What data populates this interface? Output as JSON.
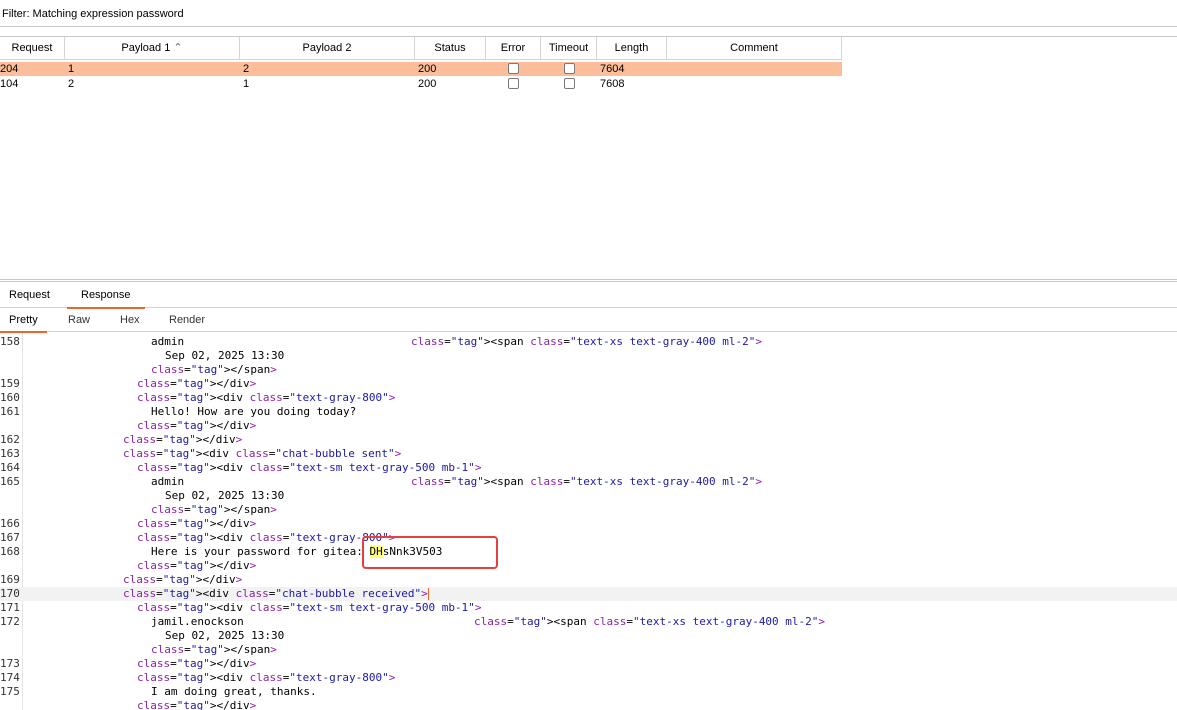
{
  "filter": {
    "text": "Filter: Matching expression password"
  },
  "table": {
    "columns": [
      "Request",
      "Payload 1",
      "Payload 2",
      "Status",
      "Error",
      "Timeout",
      "Length",
      "Comment"
    ],
    "sort_indicator": "^",
    "rows": [
      {
        "request": "204",
        "payload1": "1",
        "payload2": "2",
        "status": "200",
        "length": "7604",
        "comment": "",
        "selected": true
      },
      {
        "request": "104",
        "payload1": "2",
        "payload2": "1",
        "status": "200",
        "length": "7608",
        "comment": "",
        "selected": false
      }
    ]
  },
  "tabs": {
    "request": "Request",
    "response": "Response"
  },
  "subtabs": {
    "pretty": "Pretty",
    "raw": "Raw",
    "hex": "Hex",
    "render": "Render"
  },
  "code": {
    "lines": [
      {
        "n": "158",
        "t1": "admin",
        "t2": "<span class=\"text-xs text-gray-400 ml-2\">"
      },
      {
        "n": "",
        "t1": "Sep 02, 2025 13:30"
      },
      {
        "n": "",
        "t1": "</span>"
      },
      {
        "n": "159",
        "t1": "</div>"
      },
      {
        "n": "160",
        "t1": "<div class=\"text-gray-800\">"
      },
      {
        "n": "161",
        "t1": "Hello! How are you doing today?"
      },
      {
        "n": "",
        "t1": "</div>"
      },
      {
        "n": "162",
        "t1": "</div>"
      },
      {
        "n": "163",
        "t1": "<div class=\"chat-bubble sent\">"
      },
      {
        "n": "164",
        "t1": "<div class=\"text-sm text-gray-500 mb-1\">"
      },
      {
        "n": "165",
        "t1": "admin",
        "t2": "<span class=\"text-xs text-gray-400 ml-2\">"
      },
      {
        "n": "",
        "t1": "Sep 02, 2025 13:30"
      },
      {
        "n": "",
        "t1": "</span>"
      },
      {
        "n": "166",
        "t1": "</div>"
      },
      {
        "n": "167",
        "t1": "<div class=\"text-gray-800\">"
      },
      {
        "n": "168",
        "t1": "Here is your password for gitea: ",
        "hl": "DH",
        "t3": "sNnk3V503"
      },
      {
        "n": "",
        "t1": "</div>"
      },
      {
        "n": "169",
        "t1": "</div>"
      },
      {
        "n": "170",
        "t1": "<div class=\"chat-bubble received\">"
      },
      {
        "n": "171",
        "t1": "<div class=\"text-sm text-gray-500 mb-1\">"
      },
      {
        "n": "172",
        "t1": "jamil.enockson",
        "t2": "<span class=\"text-xs text-gray-400 ml-2\">"
      },
      {
        "n": "",
        "t1": "Sep 02, 2025 13:30"
      },
      {
        "n": "",
        "t1": "</span>"
      },
      {
        "n": "173",
        "t1": "</div>"
      },
      {
        "n": "174",
        "t1": "<div class=\"text-gray-800\">"
      },
      {
        "n": "175",
        "t1": "I am doing great, thanks."
      },
      {
        "n": "",
        "t1": "</div>"
      }
    ]
  },
  "colors": {
    "accent": "#e8672a",
    "selected_row": "#fbbd9a",
    "highlight": "#ffff7a",
    "annotation": "#e3413f"
  }
}
